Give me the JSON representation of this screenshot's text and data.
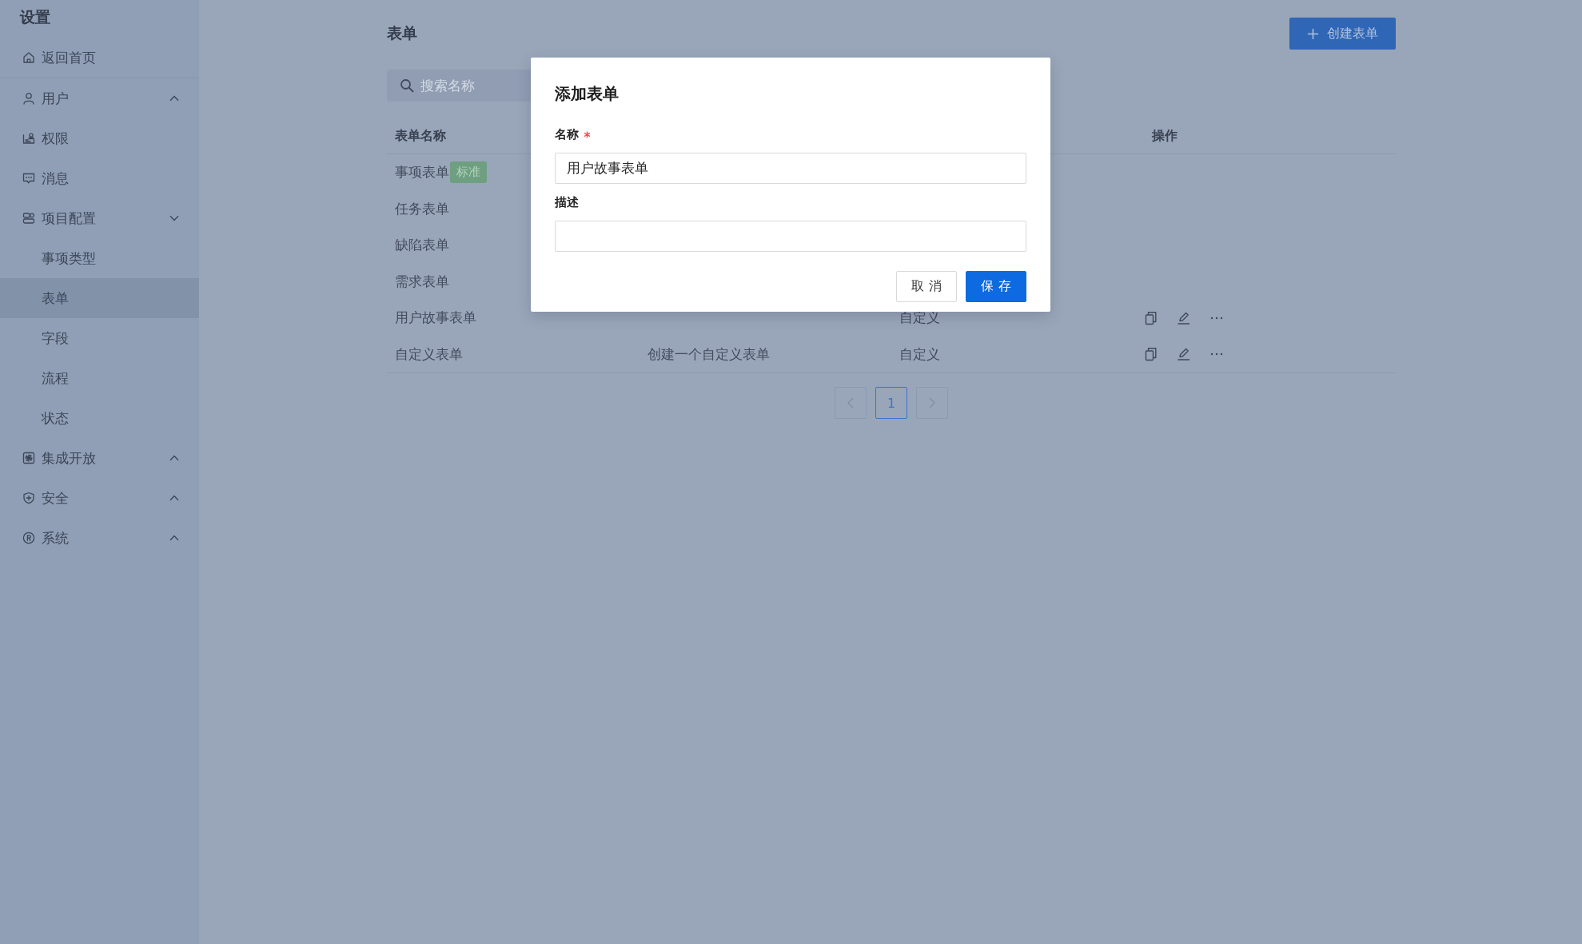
{
  "sidebar": {
    "title": "设置",
    "items": [
      {
        "label": "返回首页",
        "selected": false
      },
      {
        "label": "用户",
        "selected": false,
        "expanded": false
      },
      {
        "label": "权限",
        "selected": false
      },
      {
        "label": "消息",
        "selected": false
      },
      {
        "label": "项目配置",
        "selected": false,
        "expanded": true,
        "children": [
          {
            "label": "事项类型",
            "selected": false
          },
          {
            "label": "表单",
            "selected": true
          },
          {
            "label": "字段",
            "selected": false
          },
          {
            "label": "流程",
            "selected": false
          },
          {
            "label": "状态",
            "selected": false
          }
        ]
      },
      {
        "label": "集成开放",
        "selected": false,
        "expanded": false
      },
      {
        "label": "安全",
        "selected": false,
        "expanded": false
      },
      {
        "label": "系统",
        "selected": false,
        "expanded": false
      }
    ]
  },
  "page": {
    "title": "表单",
    "create_button": "创建表单",
    "search": {
      "placeholder": "搜索名称"
    }
  },
  "table": {
    "columns": {
      "name": "表单名称",
      "actions": "操作"
    },
    "rows": [
      {
        "name": "事项表单",
        "tag": "标准",
        "actions": false
      },
      {
        "name": "任务表单",
        "actions": false
      },
      {
        "name": "缺陷表单",
        "actions": false
      },
      {
        "name": "需求表单",
        "actions": false
      },
      {
        "name": "用户故事表单",
        "column_3": "自定义",
        "actions": true
      },
      {
        "name": "自定义表单",
        "column_2": "创建一个自定义表单",
        "column_3": "自定义",
        "actions": true
      }
    ]
  },
  "pagination": {
    "prev": {
      "disabled": true
    },
    "pages": [
      {
        "label": "1",
        "selected": true
      }
    ],
    "next": {
      "disabled": true
    }
  },
  "dialog": {
    "title": "添加表单",
    "fields": [
      {
        "label": "名称",
        "required": true,
        "value": "用户故事表单"
      },
      {
        "label": "描述",
        "required": false
      }
    ],
    "buttons": [
      {
        "label": "取 消",
        "kind": "default"
      },
      {
        "label": "保 存",
        "kind": "primary"
      }
    ]
  }
}
